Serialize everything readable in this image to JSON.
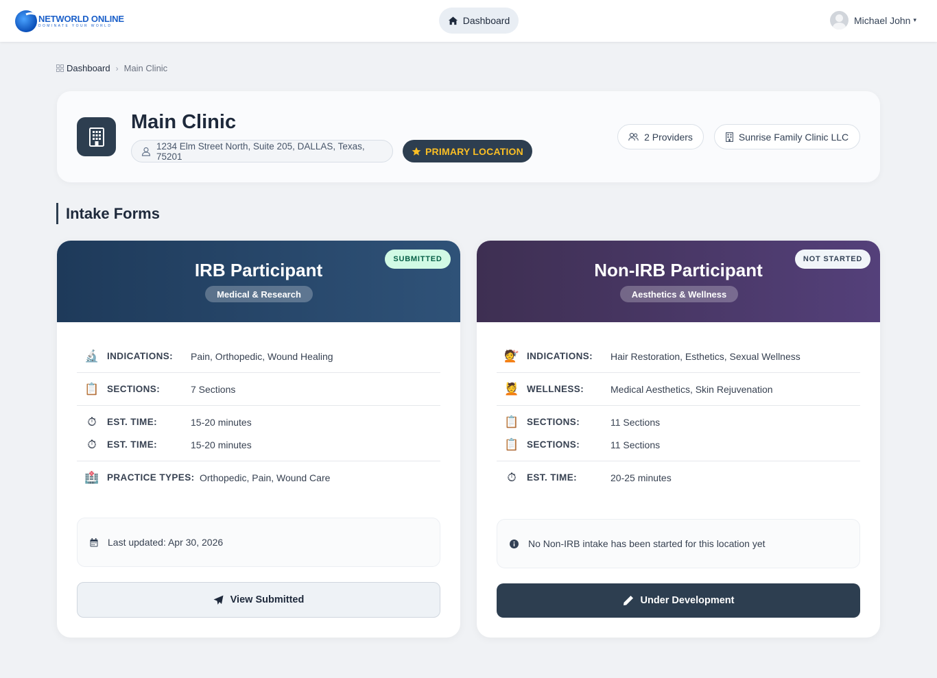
{
  "brand": {
    "name": "NETWORLD ONLINE",
    "tagline": "DOMINATE YOUR WORLD",
    "color": "#1a5fc9"
  },
  "nav": {
    "dashboard_label": "Dashboard",
    "dashboard_icon": "home-icon"
  },
  "user": {
    "name": "Michael John",
    "caret": "▾"
  },
  "breadcrumb": {
    "home": "Dashboard",
    "separator": "›",
    "current": "Main Clinic"
  },
  "location": {
    "title": "Main Clinic",
    "address": "1234 Elm Street North, Suite 205, DALLAS, Texas, 75201",
    "primary_label": "PRIMARY LOCATION",
    "providers_label": "2 Providers",
    "organization": "Sunrise Family Clinic LLC"
  },
  "section": {
    "title": "Intake Forms"
  },
  "irb_card": {
    "title": "IRB Participant",
    "subtitle": "Medical & Research",
    "status": "SUBMITTED",
    "rows": [
      {
        "icon": "microscope-icon",
        "glyph": "🔬",
        "label": "INDICATIONS:",
        "value": "Pain, Orthopedic, Wound Healing"
      },
      {
        "icon": "clipboard-icon",
        "glyph": "📋",
        "label": "SECTIONS:",
        "value": "7 Sections"
      },
      {
        "icon": "stopwatch-icon",
        "glyph": "⏱",
        "label": "EST. TIME:",
        "value": "15-20 minutes"
      },
      {
        "icon": "stopwatch-icon",
        "glyph": "⏱",
        "label": "EST. TIME:",
        "value": "15-20 minutes"
      },
      {
        "icon": "hospital-icon",
        "glyph": "🏥",
        "label": "PRACTICE TYPES:",
        "value": "Orthopedic, Pain, Wound Care"
      }
    ],
    "note": "Last updated: Apr 30, 2026",
    "button_label": "View Submitted"
  },
  "non_irb_card": {
    "title": "Non-IRB Participant",
    "subtitle": "Aesthetics & Wellness",
    "status": "NOT STARTED",
    "rows": [
      {
        "icon": "haircut-icon",
        "glyph": "💇",
        "label": "INDICATIONS:",
        "value": "Hair Restoration, Esthetics, Sexual Wellness"
      },
      {
        "icon": "spa-person-icon",
        "glyph": "💆",
        "label": "WELLNESS:",
        "value": "Medical Aesthetics, Skin Rejuvenation"
      },
      {
        "icon": "clipboard-icon",
        "glyph": "📋",
        "label": "SECTIONS:",
        "value": "11 Sections"
      },
      {
        "icon": "clipboard-icon",
        "glyph": "📋",
        "label": "SECTIONS:",
        "value": "11 Sections"
      },
      {
        "icon": "stopwatch-icon",
        "glyph": "⏱",
        "label": "EST. TIME:",
        "value": "20-25 minutes"
      }
    ],
    "note": "No Non-IRB intake has been started for this location yet",
    "button_label": "Under Development"
  },
  "colors": {
    "irb_header": "#1e3a5a",
    "non_irb_header": "#3e2f52",
    "primary_dark": "#2d3e50",
    "gold": "#fbbf24",
    "submitted_bg": "#d1fae5"
  }
}
